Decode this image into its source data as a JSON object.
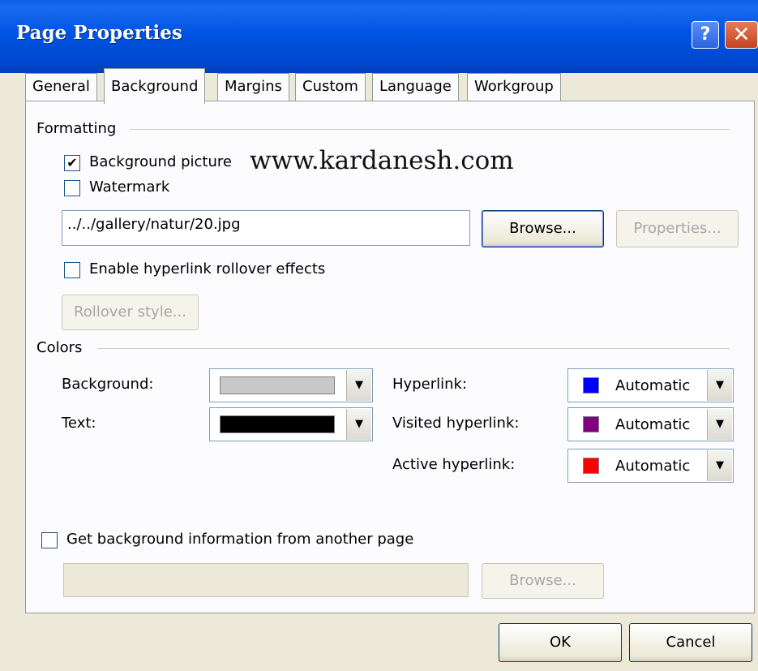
{
  "window": {
    "title": "Page Properties",
    "help_glyph": "?",
    "close_glyph": "✕"
  },
  "tabs": [
    {
      "label": "General",
      "active": false
    },
    {
      "label": "Background",
      "active": true
    },
    {
      "label": "Margins",
      "active": false
    },
    {
      "label": "Custom",
      "active": false
    },
    {
      "label": "Language",
      "active": false
    },
    {
      "label": "Workgroup",
      "active": false
    }
  ],
  "formatting": {
    "group_label": "Formatting",
    "background_picture": {
      "label": "Background picture",
      "checked": true
    },
    "watermark": {
      "label": "Watermark",
      "checked": false
    },
    "watermark_overlay_text": "www.kardanesh.com",
    "picture_path": "../../gallery/natur/20.jpg",
    "browse_label": "Browse...",
    "properties_label": "Properties...",
    "rollover_effects": {
      "label": "Enable hyperlink rollover effects",
      "checked": false
    },
    "rollover_style_label": "Rollover style..."
  },
  "colors": {
    "group_label": "Colors",
    "background": {
      "label": "Background:",
      "swatch": "#c8c8c8"
    },
    "text": {
      "label": "Text:",
      "swatch": "#000000"
    },
    "hyperlink": {
      "label": "Hyperlink:",
      "swatch": "#0000ff",
      "value": "Automatic"
    },
    "visited_hyperlink": {
      "label": "Visited hyperlink:",
      "swatch": "#800080",
      "value": "Automatic"
    },
    "active_hyperlink": {
      "label": "Active hyperlink:",
      "swatch": "#ff0000",
      "value": "Automatic"
    }
  },
  "another_page": {
    "label": "Get background information from another page",
    "checked": false,
    "path": "",
    "browse_label": "Browse..."
  },
  "footer": {
    "ok_label": "OK",
    "cancel_label": "Cancel"
  }
}
